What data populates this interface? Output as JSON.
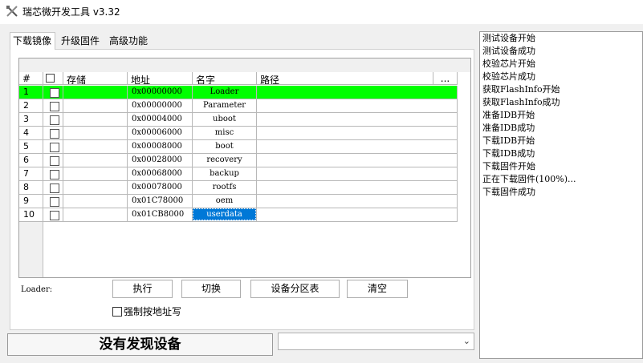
{
  "window": {
    "title": "瑞芯微开发工具 v3.32",
    "icon": "tools-icon"
  },
  "tabs": [
    {
      "label": "下载镜像",
      "active": true
    },
    {
      "label": "升级固件",
      "active": false
    },
    {
      "label": "高级功能",
      "active": false
    }
  ],
  "table": {
    "headers": {
      "index": "#",
      "storage": "存储",
      "address": "地址",
      "name": "名字",
      "path": "路径",
      "more": "..."
    },
    "rows": [
      {
        "index": "1",
        "address": "0x00000000",
        "name": "Loader",
        "selected": true
      },
      {
        "index": "2",
        "address": "0x00000000",
        "name": "Parameter"
      },
      {
        "index": "3",
        "address": "0x00004000",
        "name": "uboot"
      },
      {
        "index": "4",
        "address": "0x00006000",
        "name": "misc"
      },
      {
        "index": "5",
        "address": "0x00008000",
        "name": "boot"
      },
      {
        "index": "6",
        "address": "0x00028000",
        "name": "recovery"
      },
      {
        "index": "7",
        "address": "0x00068000",
        "name": "backup"
      },
      {
        "index": "8",
        "address": "0x00078000",
        "name": "rootfs"
      },
      {
        "index": "9",
        "address": "0x01C78000",
        "name": "oem"
      },
      {
        "index": "10",
        "address": "0x01CB8000",
        "name": "userdata",
        "focused": true
      }
    ]
  },
  "loader_label": "Loader:",
  "buttons": {
    "run": "执行",
    "switch": "切换",
    "partition": "设备分区表",
    "clear": "清空"
  },
  "force_write_label": "强制按地址写",
  "status": "没有发现设备",
  "log": [
    "测试设备开始",
    "测试设备成功",
    "校验芯片开始",
    "校验芯片成功",
    "获取FlashInfo开始",
    "获取FlashInfo成功",
    "准备IDB开始",
    "准备IDB成功",
    "下载IDB开始",
    "下载IDB成功",
    "下载固件开始",
    "正在下载固件(100%)...",
    "下载固件成功"
  ]
}
